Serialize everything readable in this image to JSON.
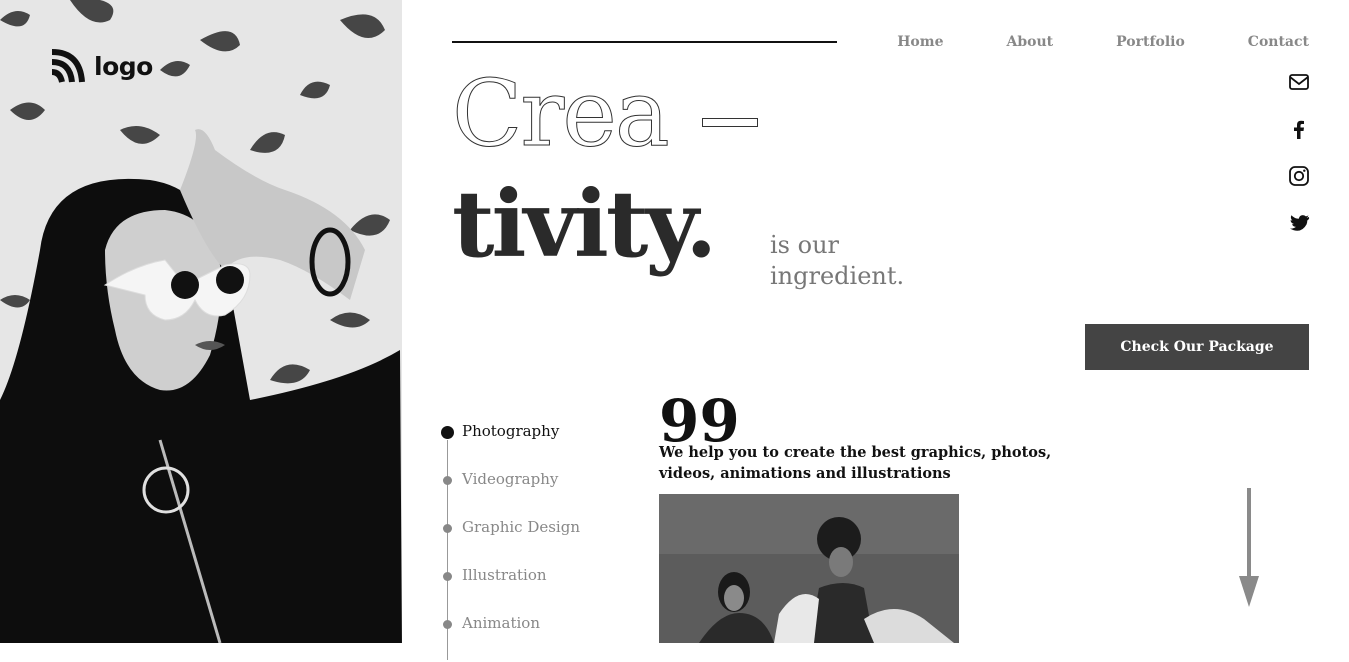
{
  "brand": {
    "logo_text": "logo"
  },
  "nav": {
    "items": [
      {
        "label": "Home"
      },
      {
        "label": "About"
      },
      {
        "label": "Portfolio"
      },
      {
        "label": "Contact"
      }
    ]
  },
  "social": [
    {
      "icon": "mail-icon"
    },
    {
      "icon": "facebook-icon"
    },
    {
      "icon": "instagram-icon"
    },
    {
      "icon": "twitter-icon"
    }
  ],
  "hero": {
    "headline_part1": "Crea",
    "headline_part2": "tivity.",
    "tagline": "is our ingredient.",
    "cta_label": "Check Our Package"
  },
  "services": [
    {
      "label": "Photography",
      "active": true
    },
    {
      "label": "Videography",
      "active": false
    },
    {
      "label": "Graphic Design",
      "active": false
    },
    {
      "label": "Illustration",
      "active": false
    },
    {
      "label": "Animation",
      "active": false
    }
  ],
  "quote": {
    "mark": "99",
    "text": "We help you to create the best graphics, photos, videos, animations and illustrations"
  },
  "colors": {
    "accent": "#444444",
    "muted": "#888888",
    "ink": "#111111"
  }
}
